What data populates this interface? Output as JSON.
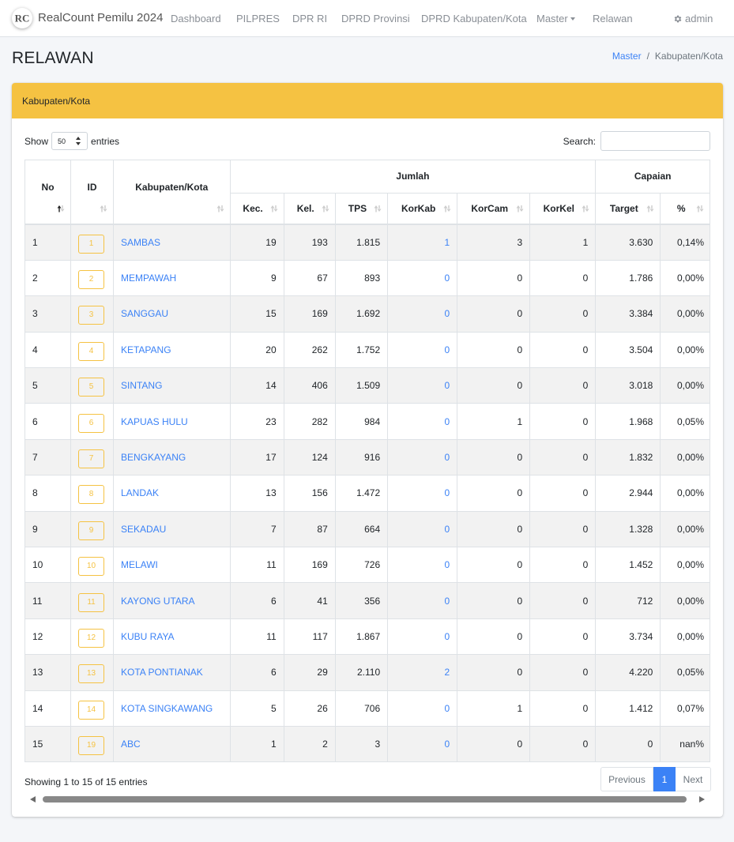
{
  "navbar": {
    "logo_text": "RC",
    "brand": "RealCount Pemilu 2024",
    "items": [
      "Dashboard",
      "PILPRES",
      "DPR RI",
      "DPRD Provinsi",
      "DPRD Kabupaten/Kota",
      "Master",
      "Relawan"
    ],
    "user": "admin"
  },
  "page": {
    "title": "RELAWAN",
    "breadcrumb": [
      "Master",
      "Kabupaten/Kota"
    ]
  },
  "card": {
    "title": "Kabupaten/Kota"
  },
  "controls": {
    "show_label": "Show",
    "entries_value": "50",
    "entries_label": "entries",
    "search_label": "Search:",
    "search_value": ""
  },
  "table": {
    "group_headers": {
      "jumlah": "Jumlah",
      "capaian": "Capaian"
    },
    "columns": [
      "No",
      "ID",
      "Kabupaten/Kota",
      "Kec.",
      "Kel.",
      "TPS",
      "KorKab",
      "KorCam",
      "KorKel",
      "Target",
      "%"
    ],
    "rows": [
      [
        "1",
        "1",
        "SAMBAS",
        "19",
        "193",
        "1.815",
        "1",
        "3",
        "1",
        "3.630",
        "0,14%"
      ],
      [
        "2",
        "2",
        "MEMPAWAH",
        "9",
        "67",
        "893",
        "0",
        "0",
        "0",
        "1.786",
        "0,00%"
      ],
      [
        "3",
        "3",
        "SANGGAU",
        "15",
        "169",
        "1.692",
        "0",
        "0",
        "0",
        "3.384",
        "0,00%"
      ],
      [
        "4",
        "4",
        "KETAPANG",
        "20",
        "262",
        "1.752",
        "0",
        "0",
        "0",
        "3.504",
        "0,00%"
      ],
      [
        "5",
        "5",
        "SINTANG",
        "14",
        "406",
        "1.509",
        "0",
        "0",
        "0",
        "3.018",
        "0,00%"
      ],
      [
        "6",
        "6",
        "KAPUAS HULU",
        "23",
        "282",
        "984",
        "0",
        "1",
        "0",
        "1.968",
        "0,05%"
      ],
      [
        "7",
        "7",
        "BENGKAYANG",
        "17",
        "124",
        "916",
        "0",
        "0",
        "0",
        "1.832",
        "0,00%"
      ],
      [
        "8",
        "8",
        "LANDAK",
        "13",
        "156",
        "1.472",
        "0",
        "0",
        "0",
        "2.944",
        "0,00%"
      ],
      [
        "9",
        "9",
        "SEKADAU",
        "7",
        "87",
        "664",
        "0",
        "0",
        "0",
        "1.328",
        "0,00%"
      ],
      [
        "10",
        "10",
        "MELAWI",
        "11",
        "169",
        "726",
        "0",
        "0",
        "0",
        "1.452",
        "0,00%"
      ],
      [
        "11",
        "11",
        "KAYONG UTARA",
        "6",
        "41",
        "356",
        "0",
        "0",
        "0",
        "712",
        "0,00%"
      ],
      [
        "12",
        "12",
        "KUBU RAYA",
        "11",
        "117",
        "1.867",
        "0",
        "0",
        "0",
        "3.734",
        "0,00%"
      ],
      [
        "13",
        "13",
        "KOTA PONTIANAK",
        "6",
        "29",
        "2.110",
        "2",
        "0",
        "0",
        "4.220",
        "0,05%"
      ],
      [
        "14",
        "14",
        "KOTA SINGKAWANG",
        "5",
        "26",
        "706",
        "0",
        "1",
        "0",
        "1.412",
        "0,07%"
      ],
      [
        "15",
        "19",
        "ABC",
        "1",
        "2",
        "3",
        "0",
        "0",
        "0",
        "0",
        "nan%"
      ]
    ]
  },
  "footer": {
    "info": "Showing 1 to 15 of 15 entries",
    "prev": "Previous",
    "page": "1",
    "next": "Next"
  },
  "colors": {
    "accent_yellow": "#f5c242",
    "link_blue": "#3b82f6"
  }
}
